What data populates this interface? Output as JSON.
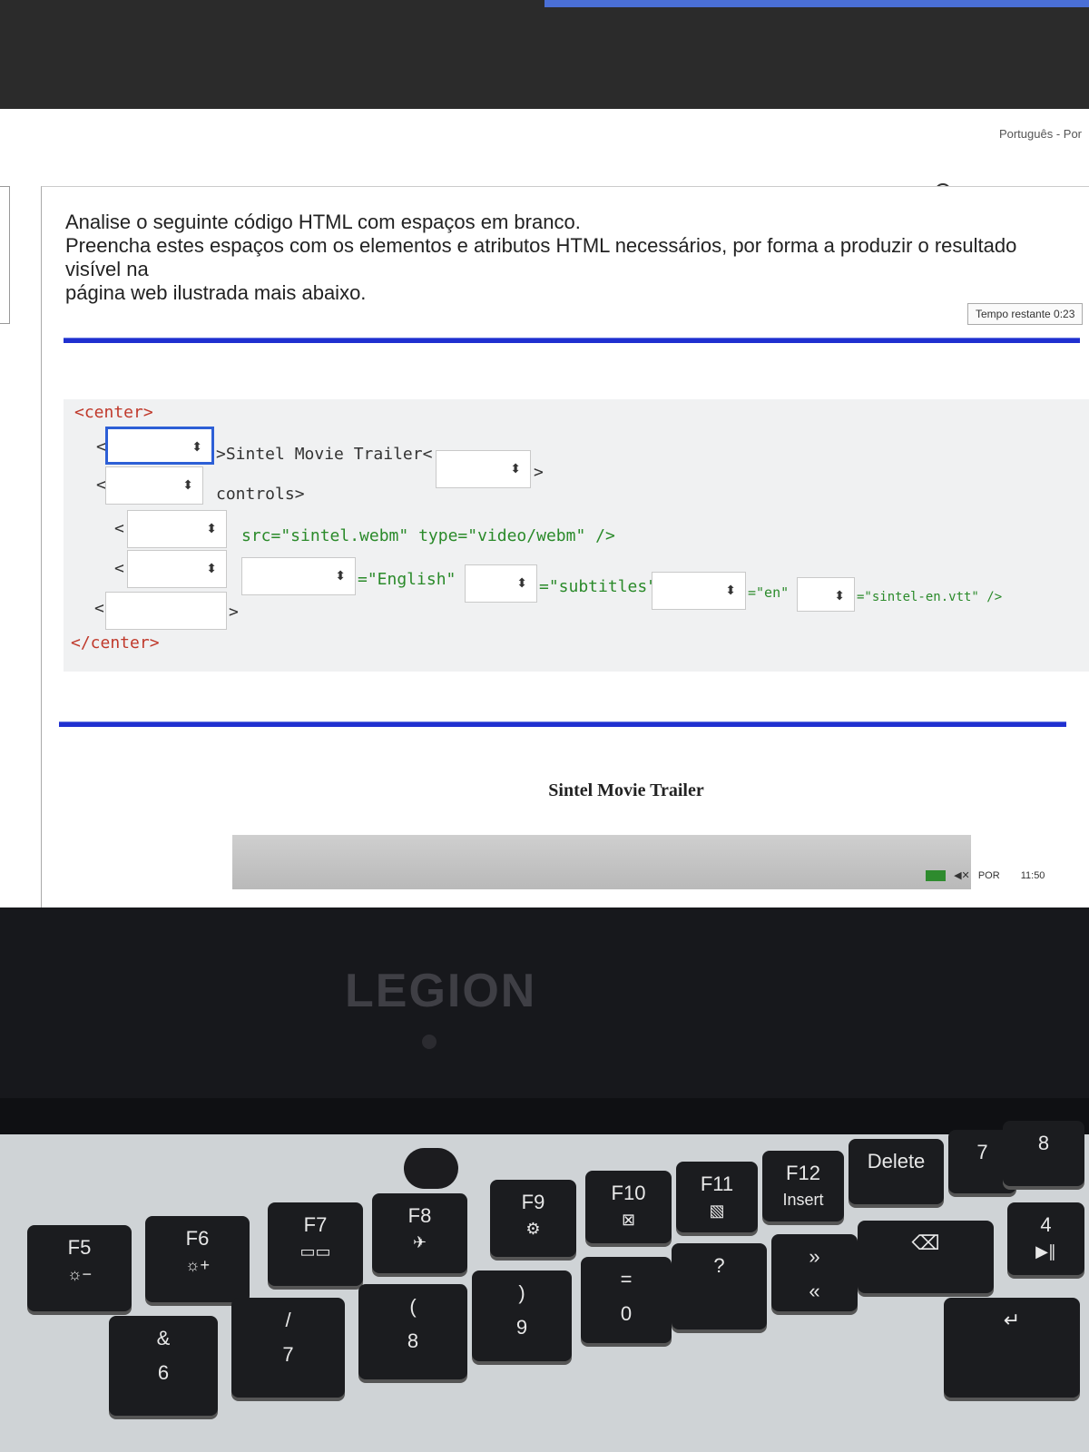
{
  "header": {
    "language": "Português - Por",
    "timer": "Tempo restante 0:23"
  },
  "question": {
    "line1": "Analise o seguinte código HTML com espaços em branco.",
    "line2": "Preencha estes espaços com os elementos e atributos HTML necessários, por forma a produzir o resultado visível na",
    "line3": "página web ilustrada mais abaixo."
  },
  "code": {
    "center_open": "<center>",
    "center_close": "</center>",
    "lt": "<",
    "gt": ">",
    "title_text": ">Sintel Movie Trailer<",
    "controls": "controls>",
    "source_attrs": "src=\"sintel.webm\" type=\"video/webm\" />",
    "english": "=\"English\"",
    "subtitles": "=\"subtitles\"",
    "en": "=\"en\"",
    "vtt": "=\"sintel-en.vtt\" />",
    "select_arrows": "⬍"
  },
  "preview": {
    "title": "Sintel Movie Trailer"
  },
  "taskbar": {
    "lang": "POR",
    "time": "11:50"
  },
  "laptop": {
    "logo": "LEGION"
  },
  "keys": {
    "f5": "F5",
    "f6": "F6",
    "f7": "F7",
    "f8": "F8",
    "f9": "F9",
    "f10": "F10",
    "f11": "F11",
    "f12": "F12",
    "insert": "Insert",
    "delete": "Delete",
    "n6": "6",
    "n7": "7",
    "n8": "8",
    "n9": "9",
    "n0": "0",
    "kp7": "7",
    "kp8": "8",
    "kp4": "4"
  }
}
